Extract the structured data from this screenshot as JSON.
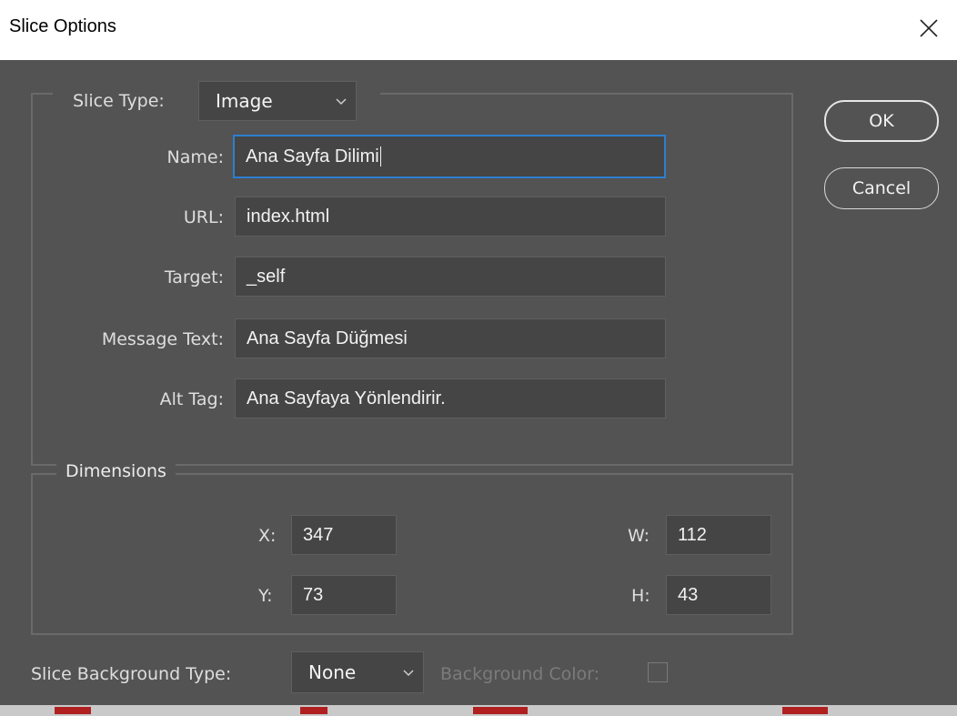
{
  "window": {
    "title": "Slice Options"
  },
  "slice_type": {
    "label": "Slice Type:",
    "value": "Image"
  },
  "fields": {
    "name": {
      "label": "Name:",
      "value": "Ana Sayfa Dilimi"
    },
    "url": {
      "label": "URL:",
      "value": "index.html"
    },
    "target": {
      "label": "Target:",
      "value": "_self"
    },
    "message": {
      "label": "Message Text:",
      "value": "Ana Sayfa Düğmesi"
    },
    "alt": {
      "label": "Alt Tag:",
      "value": "Ana Sayfaya Yönlendirir."
    }
  },
  "dimensions": {
    "legend": "Dimensions",
    "x": {
      "label": "X:",
      "value": "347"
    },
    "y": {
      "label": "Y:",
      "value": "73"
    },
    "w": {
      "label": "W:",
      "value": "112"
    },
    "h": {
      "label": "H:",
      "value": "43"
    }
  },
  "buttons": {
    "ok": "OK",
    "cancel": "Cancel"
  },
  "background": {
    "type_label": "Slice Background Type:",
    "type_value": "None",
    "color_label": "Background Color:"
  },
  "colors": {
    "dialog_bg": "#535353",
    "field_bg": "#454545",
    "focus_border": "#2d7fd0"
  }
}
